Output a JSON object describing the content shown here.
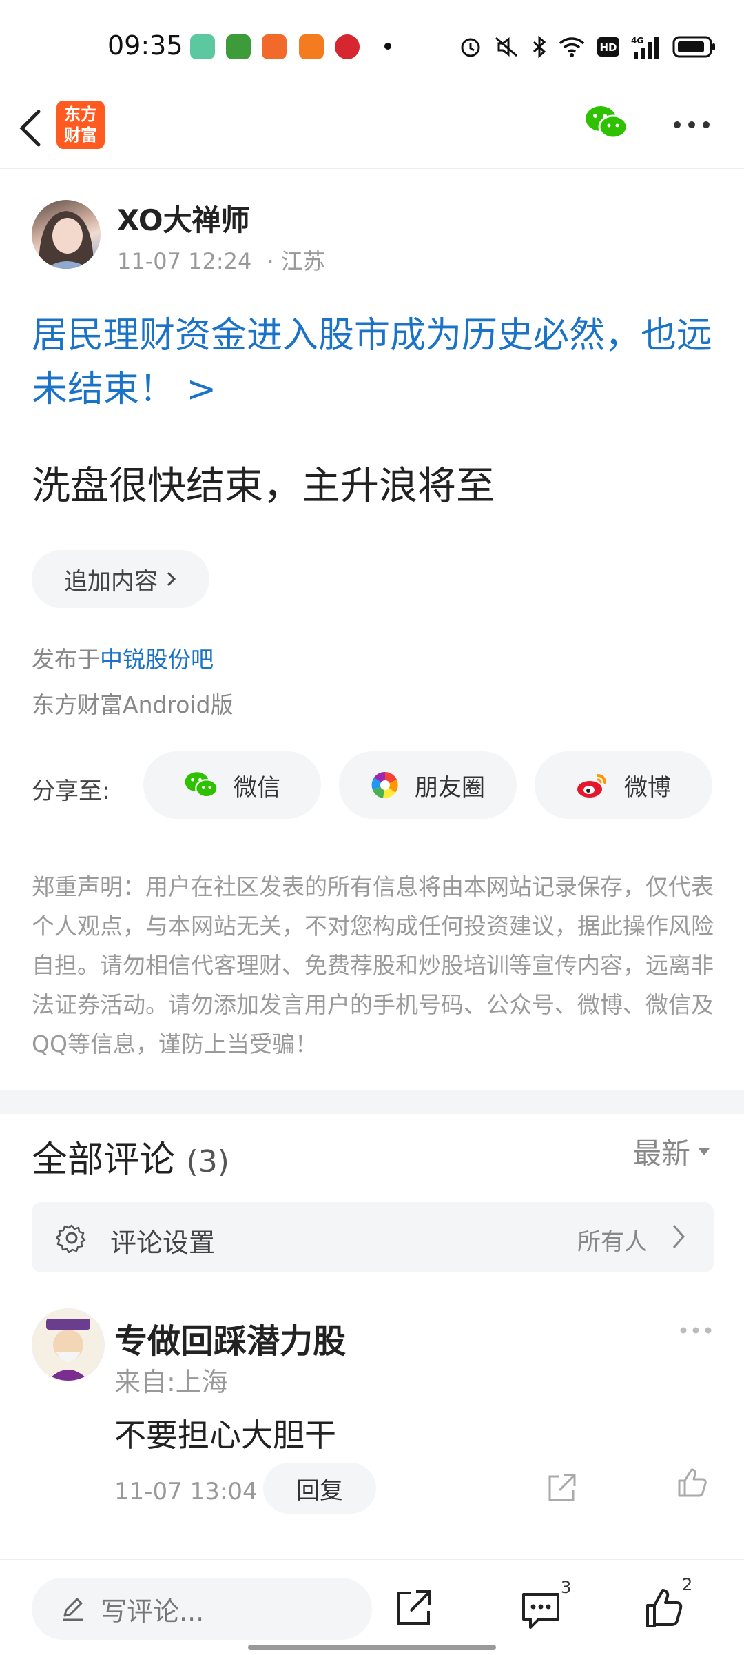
{
  "status_bar": {
    "time": "09:35",
    "apps": [
      "phone",
      "oppo",
      "video",
      "toutiao",
      "unionpay"
    ],
    "icons": [
      "alarm-icon",
      "mute-icon",
      "bluetooth-icon",
      "wifi-icon",
      "hd-icon",
      "4g-signal-icon",
      "battery-icon"
    ]
  },
  "nav": {
    "back_icon": "back-chevron-icon",
    "logo_text_1": "东方",
    "logo_text_2": "财富",
    "wechat_icon": "wechat-icon",
    "more_icon": "more-dots-icon"
  },
  "post": {
    "author": "XO大禅师",
    "time": "11-07 12:24",
    "location": "· 江苏",
    "topic": "居民理财资金进入股市成为历史必然，也远未结束！ >",
    "body": "洗盘很快结束，主升浪将至",
    "add_content": "追加内容",
    "published_prefix": "发布于",
    "published_bar": "中锐股份吧",
    "platform": "东方财富Android版"
  },
  "share": {
    "label": "分享至:",
    "wechat": "微信",
    "moments": "朋友圈",
    "weibo": "微博"
  },
  "disclaimer": "郑重声明：用户在社区发表的所有信息将由本网站记录保存，仅代表个人观点，与本网站无关，不对您构成任何投资建议，据此操作风险自担。请勿相信代客理财、免费荐股和炒股培训等宣传内容，远离非法证券活动。请勿添加发言用户的手机号码、公众号、微博、微信及QQ等信息，谨防上当受骗！",
  "comments": {
    "title": "全部评论",
    "count": "(3)",
    "sort": "最新",
    "settings_label": "评论设置",
    "settings_value": "所有人",
    "items": [
      {
        "name": "专做回踩潜力股",
        "location": "来自:上海",
        "text": "不要担心大胆干",
        "time": "11-07 13:04",
        "reply": "回复"
      }
    ]
  },
  "bottom_bar": {
    "input_placeholder": "写评论...",
    "comment_count": "3",
    "like_count": "2"
  },
  "colors": {
    "link_blue": "#1a73c7",
    "brand_orange": "#ff5a1f",
    "wechat_green": "#2dc100",
    "weibo_red": "#e6162d"
  }
}
